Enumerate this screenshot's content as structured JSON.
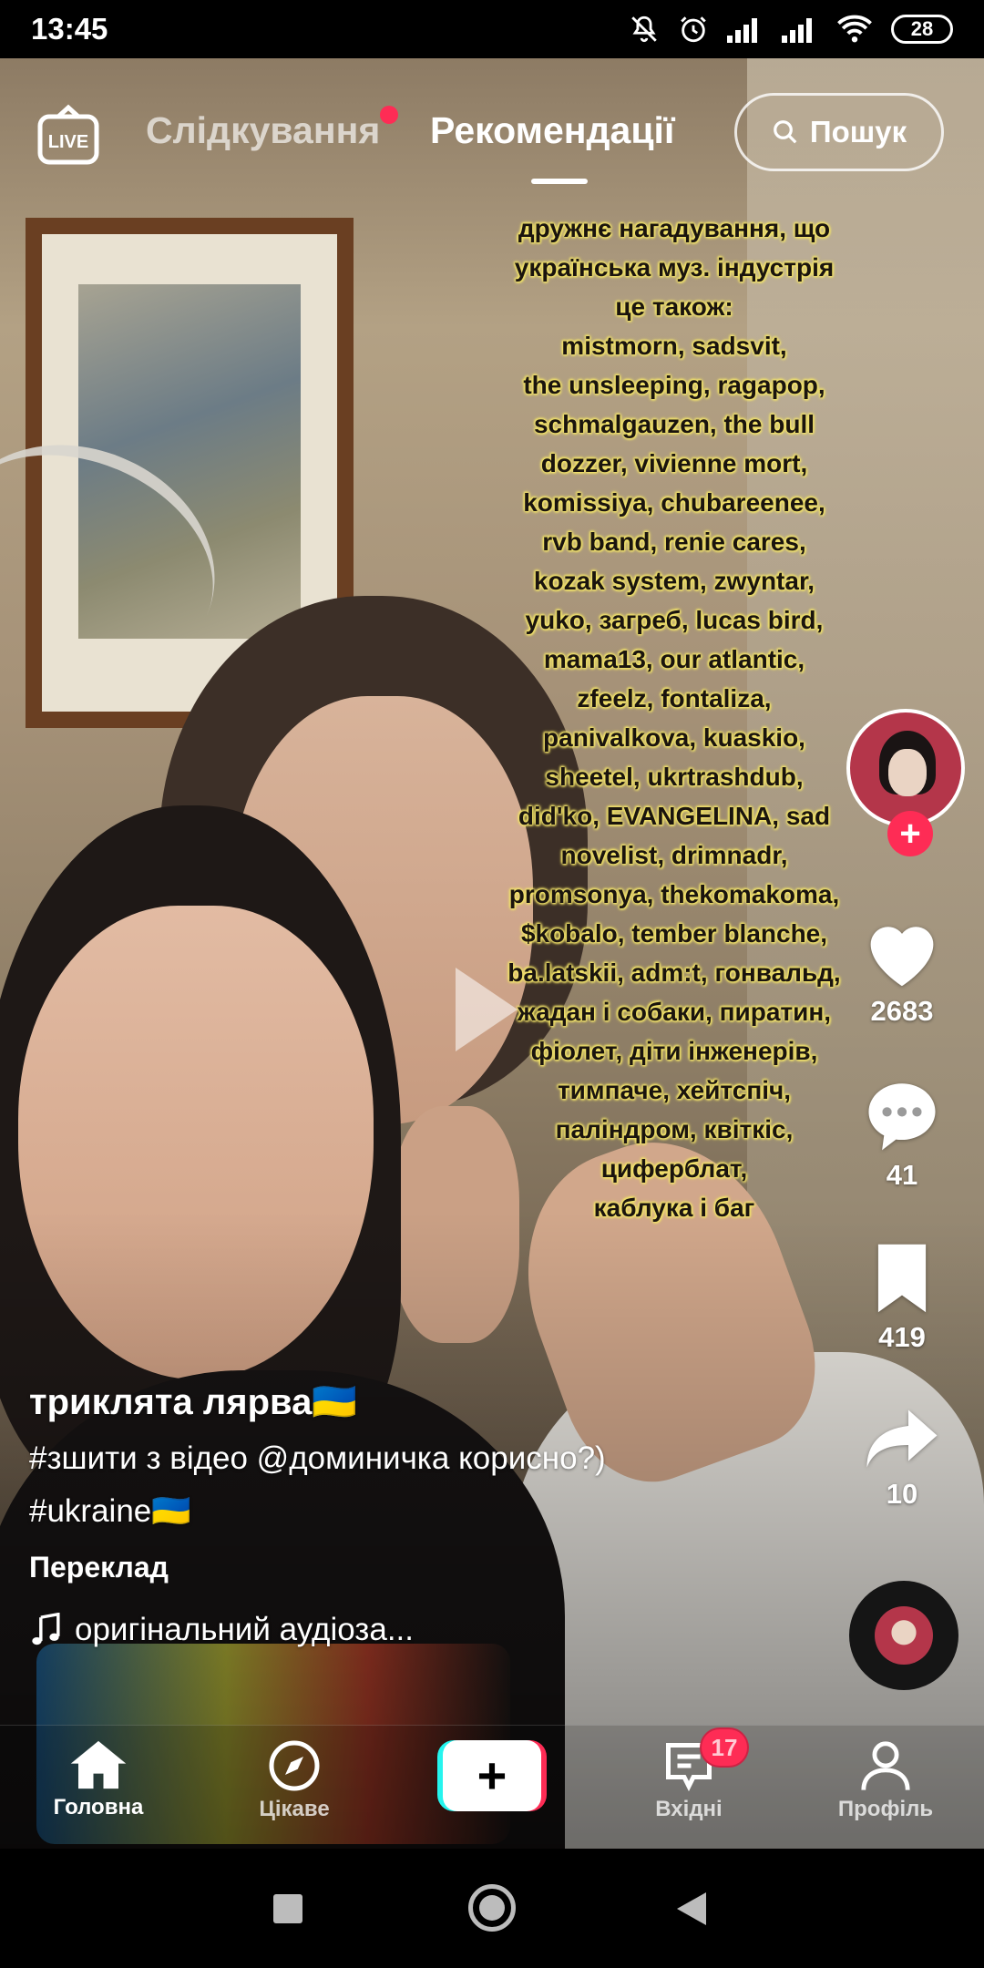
{
  "status_bar": {
    "time": "13:45",
    "battery": "28",
    "icons": [
      "mute-bell-icon",
      "alarm-icon",
      "signal-icon",
      "signal-icon",
      "wifi-icon",
      "battery-icon"
    ]
  },
  "top_nav": {
    "live_label": "LIVE",
    "tab_following": "Слідкування",
    "tab_for_you": "Рекомендації",
    "search_label": "Пошук",
    "following_has_new": true
  },
  "video": {
    "overlay_lines": [
      "дружнє нагадування, що",
      "українська муз. індустрія",
      "це також:",
      "mistmorn, sadsvit,",
      "the unsleeping, ragapop,",
      "schmalgauzen, the bull",
      "dozzer, vivienne mort,",
      "komissiya, chubareenee,",
      "rvb band, renie cares,",
      "kozak system, zwyntar,",
      "yuko, загреб, lucas bird,",
      "mama13, our atlantic,",
      "zfeelz, fontaliza,",
      "panivalkova, kuaskio,",
      "sheetel, ukrtrashdub,",
      "did'ko, EVANGELINA, sad",
      "novelist, drimnadr,",
      "promsonya, thekomakoma,",
      "$kobalo, tember blanche,",
      "ba.latskii, adm:t, гонвальд,",
      "жадан і собаки, пиратин,",
      "фіолет, діти інженерів,",
      "тимпаче, хейтспіч,",
      "паліндром, квіткіс,",
      "циферблат,",
      "каблука і баг"
    ],
    "state": "paused"
  },
  "actions": {
    "likes": "2683",
    "comments": "41",
    "saves": "419",
    "shares": "10"
  },
  "caption": {
    "username": "триклята лярва🇺🇦",
    "description_line1": "#зшити з відео @доминичка корисно?)",
    "description_line2": "#ukraine🇺🇦",
    "translate_label": "Переклад",
    "sound": "оригінальний аудіоза..."
  },
  "bottom_nav": {
    "home": "Головна",
    "discover": "Цікаве",
    "inbox": "Вхідні",
    "inbox_badge": "17",
    "profile": "Профіль"
  },
  "colors": {
    "accent_red": "#fe2c55",
    "accent_cyan": "#25f4ee",
    "overlay_highlight": "#f3e46a"
  }
}
